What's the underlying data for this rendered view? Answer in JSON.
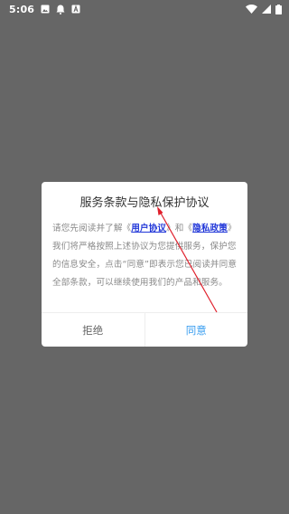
{
  "status_bar": {
    "time": "5:06",
    "left_icons": [
      "image-icon",
      "notification-icon",
      "a-box-icon"
    ],
    "right_icons": [
      "wifi-icon",
      "signal-icon",
      "battery-icon"
    ]
  },
  "dialog": {
    "title": "服务条款与隐私保护协议",
    "body": {
      "text_1": "请您先阅读并了解《",
      "user_agreement_link": "用户协议",
      "text_2": "》和《",
      "privacy_policy_link": "隐私政策",
      "text_3": "》我们将严格按照上述协议为您提供服务，保护您的信息安全，点击“同意”即表示您已阅读并同意全部条款，可以继续使用我们的产品和服务。"
    },
    "reject_button": "拒绝",
    "agree_button": "同意"
  },
  "colors": {
    "background_overlay": "#666666",
    "link": "#1f35d8",
    "agree": "#3a9ef0",
    "annotation_arrow": "#e0202c"
  }
}
